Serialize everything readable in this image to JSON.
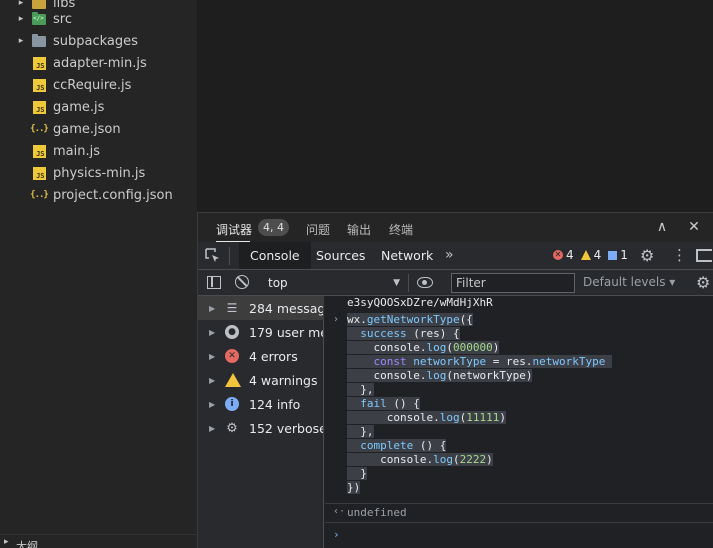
{
  "explorer": {
    "items": [
      {
        "label": "libs",
        "type": "folder-libs",
        "chevron": "▸"
      },
      {
        "label": "src",
        "type": "folder-src",
        "chevron": "▸"
      },
      {
        "label": "subpackages",
        "type": "folder",
        "chevron": "▸"
      },
      {
        "label": "adapter-min.js",
        "type": "js",
        "icon_text": "JS"
      },
      {
        "label": "ccRequire.js",
        "type": "js",
        "icon_text": "JS"
      },
      {
        "label": "game.js",
        "type": "js",
        "icon_text": "JS"
      },
      {
        "label": "game.json",
        "type": "json",
        "icon_text": "{..}"
      },
      {
        "label": "main.js",
        "type": "js",
        "icon_text": "JS"
      },
      {
        "label": "physics-min.js",
        "type": "js",
        "icon_text": "JS"
      },
      {
        "label": "project.config.json",
        "type": "json",
        "icon_text": "{..}"
      }
    ],
    "outline_label": "大纲"
  },
  "panel": {
    "tabs": {
      "debugger": "调试器",
      "issues": "问题",
      "output": "输出",
      "terminal": "终端"
    },
    "badge": "4, 4",
    "collapse_glyph": "∧",
    "close_glyph": "✕"
  },
  "devtools": {
    "tabs": {
      "console": "Console",
      "sources": "Sources",
      "network": "Network"
    },
    "more_glyph": "»",
    "counts": {
      "errors": "4",
      "warnings": "4",
      "info": "1"
    },
    "gear_glyph": "⚙",
    "kebab_glyph": "⋮"
  },
  "filter": {
    "context": "top",
    "placeholder": "Filter",
    "levels": "Default levels ▾"
  },
  "sidebar": {
    "items": [
      {
        "label": "284 messag...",
        "icon": "list-icon",
        "glyph": "☰"
      },
      {
        "label": "179 user me...",
        "icon": "user-icon",
        "glyph": "●"
      },
      {
        "label": "4 errors",
        "icon": "error-icon",
        "glyph": "✕"
      },
      {
        "label": "4 warnings",
        "icon": "warning-icon",
        "glyph": "!"
      },
      {
        "label": "124 info",
        "icon": "info-icon",
        "glyph": "i"
      },
      {
        "label": "152 verbose",
        "icon": "verbose-icon",
        "glyph": "⚙"
      }
    ]
  },
  "console": {
    "truncated_line": "e3syQOOSxDZre/wMdHjXhR",
    "code": {
      "l1a": "wx.",
      "l1b": "getNetworkType",
      "l1c": "({",
      "l2a": "  ",
      "l2b": "success",
      "l2c": " (",
      "l2d": "res",
      "l2e": ") {",
      "l3a": "    console.",
      "l3b": "log",
      "l3c": "(",
      "l3d": "000000",
      "l3e": ")",
      "l4a": "    ",
      "l4b": "const",
      "l4c": " ",
      "l4d": "networkType",
      "l4e": " = res.",
      "l4f": "networkType",
      "l5a": "    console.",
      "l5b": "log",
      "l5c": "(networkType)",
      "l6": "  },",
      "l7a": "  ",
      "l7b": "fail",
      "l7c": " () {",
      "l8a": "      console.",
      "l8b": "log",
      "l8c": "(",
      "l8d": "11111",
      "l8e": ")",
      "l9": "  },",
      "l10a": "  ",
      "l10b": "complete",
      "l10c": " () {",
      "l11a": "     console.",
      "l11b": "log",
      "l11c": "(",
      "l11d": "2222",
      "l11e": ")",
      "l12": "  }",
      "l13": "})"
    },
    "result": "undefined",
    "input_arrow": "›",
    "result_arrow": "‹·",
    "prompt": "›"
  }
}
